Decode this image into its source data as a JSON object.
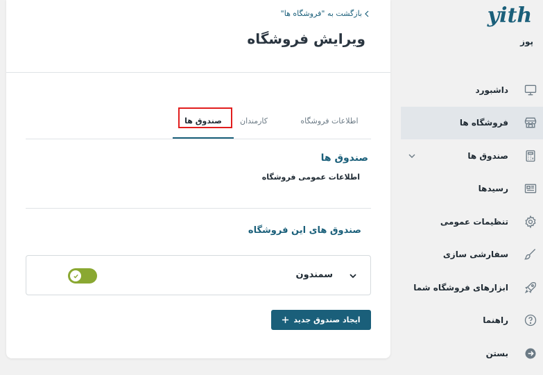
{
  "sidebar": {
    "logo_text": "yith",
    "app_name": "پوز",
    "items": [
      {
        "label": "داشبورد",
        "icon": "monitor-icon",
        "active": false
      },
      {
        "label": "فروشگاه ها",
        "icon": "store-icon",
        "active": true
      },
      {
        "label": "صندوق ها",
        "icon": "calculator-icon",
        "active": false,
        "has_submenu": true
      },
      {
        "label": "رسیدها",
        "icon": "receipt-icon",
        "active": false
      },
      {
        "label": "تنظیمات عمومی",
        "icon": "gear-icon",
        "active": false
      },
      {
        "label": "سفارشی سازی",
        "icon": "brush-icon",
        "active": false
      },
      {
        "label": "ابزارهای فروشگاه شما",
        "icon": "rocket-icon",
        "active": false
      },
      {
        "label": "راهنما",
        "icon": "help-icon",
        "active": false
      },
      {
        "label": "بستن",
        "icon": "close-arrow-icon",
        "active": false
      }
    ]
  },
  "header": {
    "back_link": "بازگشت به \"فروشگاه ها\"",
    "title": "ویرایش فروشگاه"
  },
  "tabs": [
    {
      "label": "اطلاعات فروشگاه",
      "active": false
    },
    {
      "label": "کارمندان",
      "active": false
    },
    {
      "label": "صندوق ها",
      "active": true
    }
  ],
  "section": {
    "title": "صندوق ها",
    "subtitle": "اطلاعات عمومی فروشگاه",
    "registers_title": "صندوق های این فروشگاه"
  },
  "registers": [
    {
      "name": "سمندون",
      "enabled": true
    }
  ],
  "add_button_label": "ایجاد صندوق جدید",
  "colors": {
    "accent": "#1a5f7a",
    "toggle_on": "#8aa832",
    "highlight": "#e11d1d",
    "active_menu_bg": "#e2e6ea"
  }
}
